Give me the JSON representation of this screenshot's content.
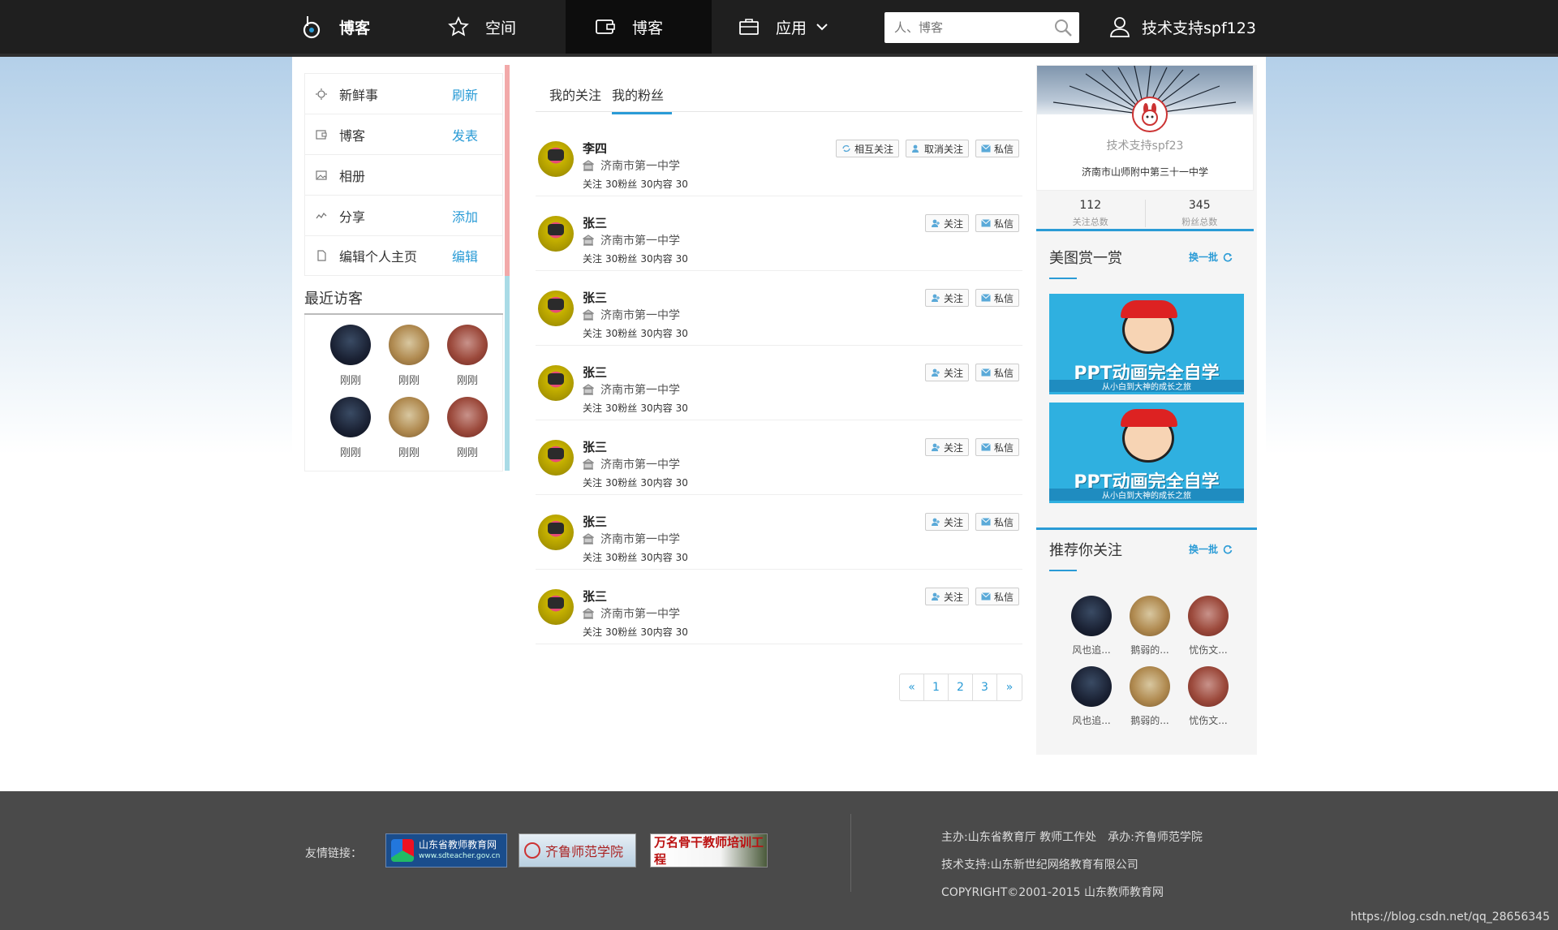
{
  "nav": {
    "logo_label": "博客",
    "items": [
      {
        "label": "空间",
        "icon": "star-icon"
      },
      {
        "label": "博客",
        "icon": "blog-icon"
      },
      {
        "label": "应用",
        "icon": "briefcase-icon"
      }
    ],
    "search_placeholder": "人、博客",
    "user_label": "技术支持spf123"
  },
  "sidebar": {
    "menu": [
      {
        "label": "新鲜事",
        "action": "刷新",
        "icon": "sun-icon"
      },
      {
        "label": "博客",
        "action": "发表",
        "icon": "blog-icon"
      },
      {
        "label": "相册",
        "action": "",
        "icon": "image-icon"
      },
      {
        "label": "分享",
        "action": "添加",
        "icon": "share-icon"
      },
      {
        "label": "编辑个人主页",
        "action": "编辑",
        "icon": "file-icon"
      }
    ],
    "visitors_title": "最近访客",
    "visitors": [
      {
        "caption": "刚刚"
      },
      {
        "caption": "刚刚"
      },
      {
        "caption": "刚刚"
      },
      {
        "caption": "刚刚"
      },
      {
        "caption": "刚刚"
      },
      {
        "caption": "刚刚"
      }
    ]
  },
  "main": {
    "tabs": [
      {
        "label": "我的关注"
      },
      {
        "label": "我的粉丝"
      }
    ],
    "stat_labels": {
      "follow": "关注",
      "fans": "粉丝",
      "content": "内容"
    },
    "buttons": {
      "mutual": "相互关注",
      "unfollow": "取消关注",
      "follow": "关注",
      "message": "私信"
    },
    "rows": [
      {
        "name": "李四",
        "school": "济南市第一中学",
        "follow": "30",
        "fans": "30",
        "content": "30"
      },
      {
        "name": "张三",
        "school": "济南市第一中学",
        "follow": "30",
        "fans": "30",
        "content": "30"
      },
      {
        "name": "张三",
        "school": "济南市第一中学",
        "follow": "30",
        "fans": "30",
        "content": "30"
      },
      {
        "name": "张三",
        "school": "济南市第一中学",
        "follow": "30",
        "fans": "30",
        "content": "30"
      },
      {
        "name": "张三",
        "school": "济南市第一中学",
        "follow": "30",
        "fans": "30",
        "content": "30"
      },
      {
        "name": "张三",
        "school": "济南市第一中学",
        "follow": "30",
        "fans": "30",
        "content": "30"
      },
      {
        "name": "张三",
        "school": "济南市第一中学",
        "follow": "30",
        "fans": "30",
        "content": "30"
      }
    ],
    "pager": [
      "«",
      "1",
      "2",
      "3",
      "»"
    ]
  },
  "profile": {
    "name": "技术支持spf23",
    "school": "济南市山师附中第三十一中学",
    "following_count": "112",
    "following_label": "关注总数",
    "fans_count": "345",
    "fans_label": "粉丝总数"
  },
  "gallery": {
    "title": "美图赏一赏",
    "refresh": "换一批",
    "banners": [
      {
        "title": "PPT动画完全自学",
        "subtitle": "从小白到大神的成长之旅"
      },
      {
        "title": "PPT动画完全自学",
        "subtitle": "从小白到大神的成长之旅"
      }
    ]
  },
  "recommend": {
    "title": "推荐你关注",
    "refresh": "换一批",
    "people": [
      {
        "name": "风也追..."
      },
      {
        "name": "鹅弱的..."
      },
      {
        "name": "忧伤文..."
      },
      {
        "name": "风也追..."
      },
      {
        "name": "鹅弱的..."
      },
      {
        "name": "忧伤文..."
      }
    ]
  },
  "footer": {
    "links_label": "友情链接：",
    "link1_title": "山东省教师教育网",
    "link1_sub": "www.sdteacher.gov.cn",
    "link2_title": "齐鲁师范学院",
    "link3_title": "万名骨干教师培训工程",
    "host": "主办:山东省教育厅 教师工作处　承办:齐鲁师范学院",
    "support": "技术支持:山东新世纪网络教育有限公司",
    "copyright": "COPYRIGHT©2001-2015 山东教师教育网",
    "watermark": "https://blog.csdn.net/qq_28656345"
  },
  "colors": {
    "accent": "#2a9bd6",
    "topbar": "#1f1f1f",
    "footer": "#4a4a4a"
  }
}
